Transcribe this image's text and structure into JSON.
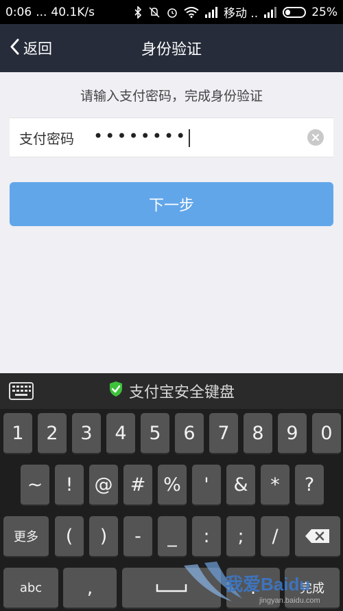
{
  "status_bar": {
    "time": "0:06",
    "dots": "...",
    "speed": "40.1K/s",
    "carrier": "移动 ..",
    "battery": "25%",
    "battery_level": 0.25
  },
  "nav": {
    "back_label": "返回",
    "title": "身份验证"
  },
  "main": {
    "prompt": "请输入支付密码，完成身份验证",
    "password_label": "支付密码",
    "password_value": "••••••••",
    "next_label": "下一步"
  },
  "keyboard": {
    "title": "支付宝安全键盘",
    "row1": [
      "1",
      "2",
      "3",
      "4",
      "5",
      "6",
      "7",
      "8",
      "9",
      "0"
    ],
    "row2": [
      "~",
      "!",
      "@",
      "#",
      "%",
      "'",
      "&",
      "*",
      "?"
    ],
    "row3": [
      "更多",
      "(",
      ")",
      "-",
      "_",
      ":",
      ";",
      "/"
    ],
    "row4_abc": "abc",
    "row4_comma": ",",
    "row4_done": "完成"
  },
  "watermark": {
    "text": "我爱Baidu",
    "url": "jingyan.baidu.com"
  },
  "colors": {
    "nav_bg": "#262c3a",
    "accent": "#62a6ea",
    "shield": "#3ec23b"
  }
}
